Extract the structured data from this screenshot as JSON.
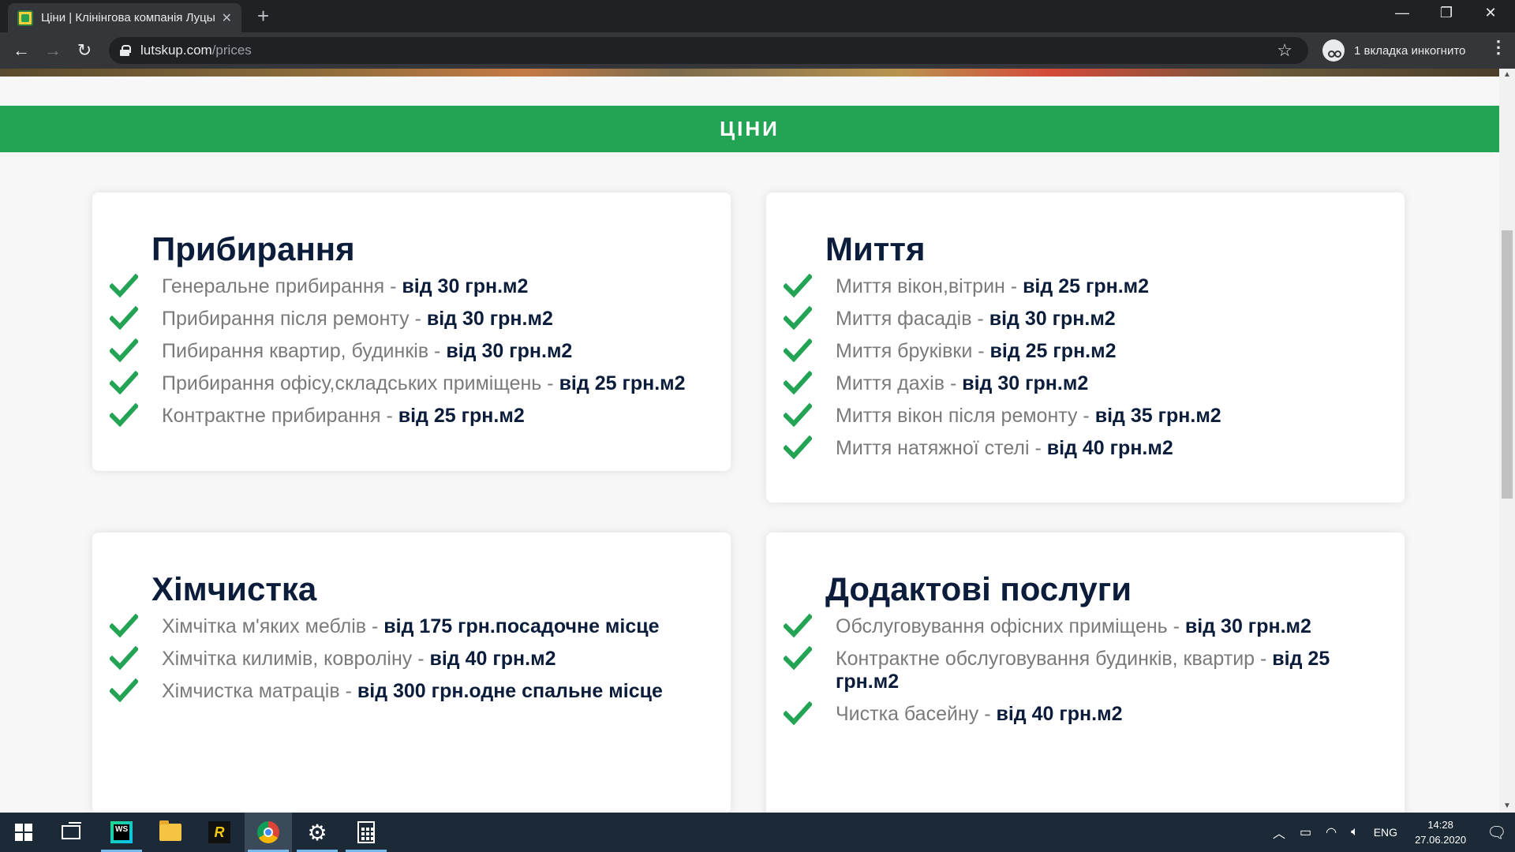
{
  "browser": {
    "tab_title": "Ціни | Клінінгова компанія Луцьк",
    "tab_close": "✕",
    "new_tab": "+",
    "url_host": "lutskup.com",
    "url_path": "/prices",
    "incognito_label": "1 вкладка инкогнито",
    "window_controls": [
      "—",
      "❐",
      "✕"
    ]
  },
  "page": {
    "banner": "ЦІНИ",
    "accent_color": "#23a455",
    "heading_color": "#0b1d3a",
    "sections": [
      {
        "title": "Прибирання",
        "items": [
          {
            "service": "Генеральне прибирання",
            "price": "від 30 грн.м2"
          },
          {
            "service": "Прибирання після ремонту",
            "price": "від 30 грн.м2"
          },
          {
            "service": "Пибирання квартир, будинків",
            "price": "від 30 грн.м2"
          },
          {
            "service": "Прибирання офісу,складських приміщень",
            "price": "від 25 грн.м2"
          },
          {
            "service": "Контрактне прибирання",
            "price": "від 25 грн.м2"
          }
        ]
      },
      {
        "title": "Миття",
        "items": [
          {
            "service": "Миття вікон,вітрин",
            "price": "від 25 грн.м2"
          },
          {
            "service": "Миття фасадів",
            "price": "від 30 грн.м2"
          },
          {
            "service": "Миття бруківки",
            "price": "від 25 грн.м2"
          },
          {
            "service": "Миття дахів",
            "price": "від 30 грн.м2"
          },
          {
            "service": "Миття вікон після ремонту",
            "price": "від 35 грн.м2"
          },
          {
            "service": "Миття натяжної стелі",
            "price": "від 40 грн.м2"
          }
        ]
      },
      {
        "title": "Хімчистка",
        "items": [
          {
            "service": "Хімчітка м'яких меблів",
            "price": "від 175 грн.посадочне місце"
          },
          {
            "service": "Хімчітка килимів, ковроліну",
            "price": "від 40 грн.м2"
          },
          {
            "service": "Хімчистка матраців",
            "price": "від 300 грн.одне спальне місце"
          }
        ]
      },
      {
        "title": "Додактові послуги",
        "items": [
          {
            "service": "Обслуговування офісних приміщень",
            "price": "від 30 грн.м2"
          },
          {
            "service": "Контрактне обслуговування будинків, квартир",
            "price": "від 25 грн.м2"
          },
          {
            "service": "Чистка басейну",
            "price": "від 40 грн.м2"
          }
        ]
      }
    ]
  },
  "taskbar": {
    "language": "ENG",
    "time": "14:28",
    "date": "27.06.2020",
    "apps": [
      "windows-start",
      "task-view",
      "webstorm",
      "file-explorer",
      "rider",
      "chrome",
      "settings",
      "calculator"
    ]
  }
}
